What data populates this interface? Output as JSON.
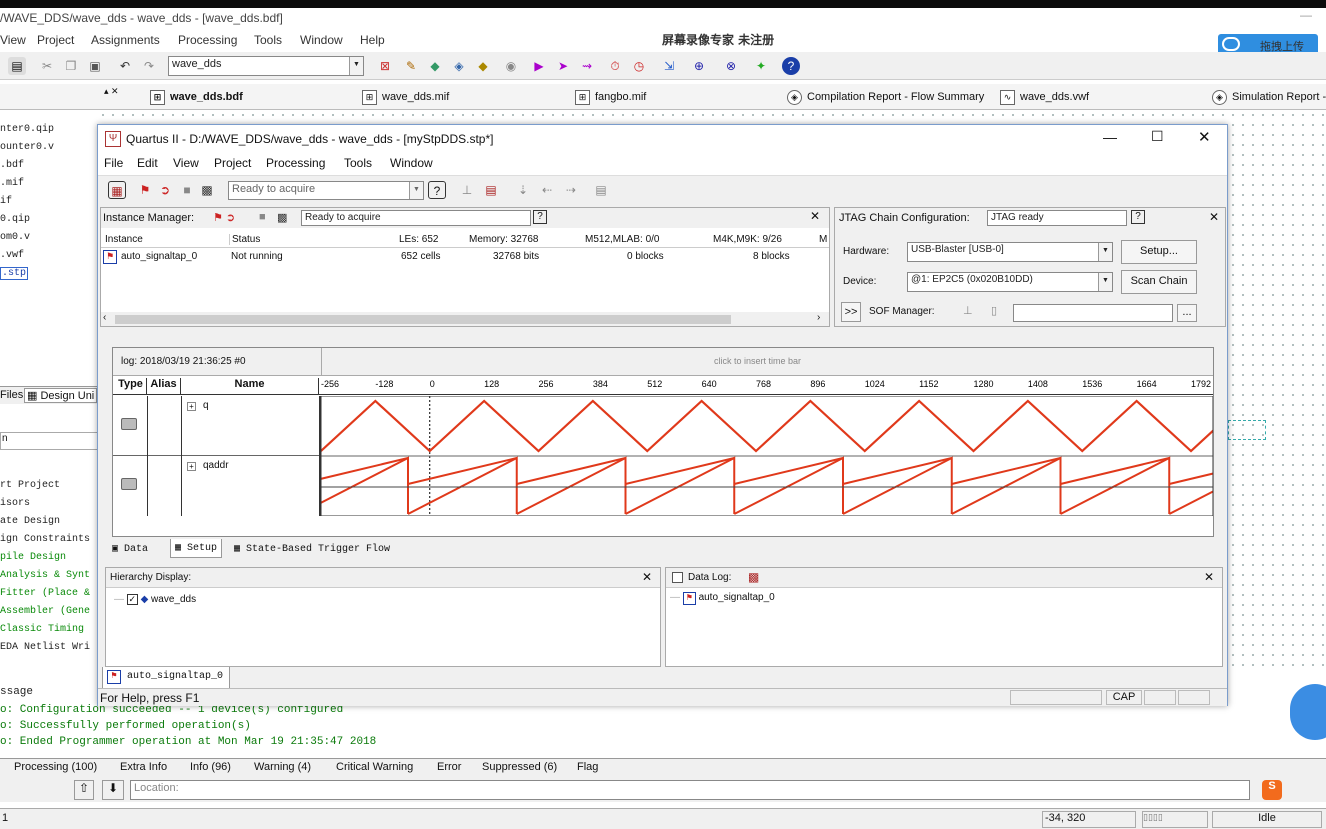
{
  "quartus": {
    "title": "/WAVE_DDS/wave_dds - wave_dds - [wave_dds.bdf]",
    "menu": [
      "View",
      "Project",
      "Assignments",
      "Processing",
      "Tools",
      "Window",
      "Help"
    ],
    "watermark": "屏幕录像专家 未注册",
    "upload_button": "拖拽上传",
    "toolbar_entity": "wave_dds",
    "tabs": [
      "wave_dds.bdf",
      "wave_dds.mif",
      "fangbo.mif",
      "Compilation Report - Flow Summary",
      "wave_dds.vwf",
      "Simulation Report -"
    ],
    "left_files": [
      "nter0.qip",
      "ounter0.v",
      ".bdf",
      ".mif",
      "if",
      "0.qip",
      "om0.v",
      ".vwf",
      ".stp"
    ],
    "left_tabs": [
      "Files",
      "Design Uni"
    ],
    "left_tasks": [
      "rt Project",
      "isors",
      "ate Design",
      "ign Constraints",
      "pile Design",
      "Analysis & Synt",
      "Fitter (Place &",
      "Assembler (Gene",
      "Classic Timing",
      "EDA Netlist Wri"
    ],
    "message_label": "ssage",
    "messages": [
      "o: Configuration succeeded -- 1 device(s) configured",
      "o: Successfully performed operation(s)",
      "o: Ended Programmer operation at Mon Mar 19 21:35:47 2018"
    ],
    "bottom_tabs": [
      "Processing (100)",
      "Extra Info",
      "Info (96)",
      "Warning (4)",
      "Critical Warning",
      "Error",
      "Suppressed (6)",
      "Flag"
    ],
    "location_label": "Location:",
    "status_coords": "-34, 320",
    "status_state": "Idle",
    "status_num": "1"
  },
  "stp": {
    "title": "Quartus II - D:/WAVE_DDS/wave_dds - wave_dds - [myStpDDS.stp*]",
    "menu": [
      "File",
      "Edit",
      "View",
      "Project",
      "Processing",
      "Tools",
      "Window"
    ],
    "toolbar_status": "Ready to acquire",
    "instance_manager": {
      "label": "Instance Manager:",
      "status": "Ready to acquire",
      "headers": [
        "Instance",
        "Status",
        "LEs: 652",
        "Memory: 32768",
        "M512,MLAB: 0/0",
        "M4K,M9K: 9/26",
        "M"
      ],
      "rows": [
        {
          "instance": "auto_signaltap_0",
          "status": "Not running",
          "les": "652 cells",
          "memory": "32768 bits",
          "m512": "0 blocks",
          "m4k": "8 blocks"
        }
      ]
    },
    "jtag": {
      "label": "JTAG Chain Configuration:",
      "status": "JTAG ready",
      "hardware_label": "Hardware:",
      "hardware": "USB-Blaster [USB-0]",
      "setup_button": "Setup...",
      "device_label": "Device:",
      "device": "@1: EP2C5 (0x020B10DD)",
      "scan_button": "Scan Chain",
      "sof_toggle": ">>",
      "sof_label": "SOF Manager:",
      "browse_button": "..."
    },
    "waveform": {
      "log_label": "log: 2018/03/19 21:36:25  #0",
      "insert_hint": "click to insert time bar",
      "col_type": "Type",
      "col_alias": "Alias",
      "col_name": "Name",
      "ticks": [
        "-256",
        "-128",
        "0",
        "128",
        "256",
        "384",
        "512",
        "640",
        "768",
        "896",
        "1024",
        "1152",
        "1280",
        "1408",
        "1536",
        "1664",
        "1792"
      ],
      "signals": [
        {
          "name": "q",
          "waveform": "triangle"
        },
        {
          "name": "qaddr",
          "waveform": "sawtooth"
        }
      ]
    },
    "lower_tabs": [
      "Data",
      "Setup",
      "State-Based Trigger Flow"
    ],
    "hierarchy": {
      "label": "Hierarchy Display:",
      "item": "wave_dds"
    },
    "datalog": {
      "label": "Data Log:",
      "item": "auto_signaltap_0"
    },
    "instance_tab": "auto_signaltap_0",
    "help_text": "For Help, press F1",
    "cap": "CAP"
  }
}
